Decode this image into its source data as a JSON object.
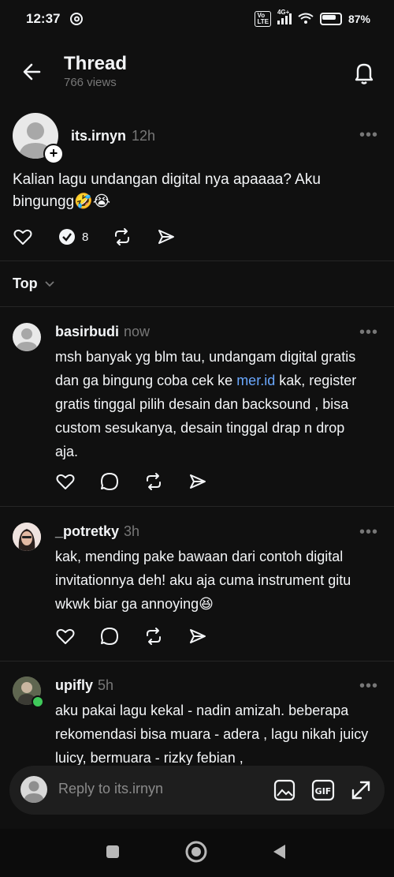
{
  "status_bar": {
    "time": "12:37",
    "network": "4G+",
    "battery": "87%"
  },
  "header": {
    "title": "Thread",
    "views": "766 views"
  },
  "post": {
    "username": "its.irnyn",
    "time": "12h",
    "text": "Kalian lagu undangan digital nya apaaaa? Aku bingungg🤣😭",
    "reply_count": "8"
  },
  "sort": {
    "label": "Top"
  },
  "replies": [
    {
      "username": "basirbudi",
      "time": "now",
      "text_before": "msh banyak yg blm tau, undangam digital gratis dan ga bingung coba cek ke ",
      "link": "mer.id",
      "text_after": " kak, register gratis tinggal pilih desain dan backsound , bisa custom sesukanya, desain tinggal drap n drop aja."
    },
    {
      "username": "_potretky",
      "time": "3h",
      "text": "kak, mending pake bawaan dari contoh digital invitationnya deh! aku aja cuma instrument gitu wkwk biar ga annoying😆"
    },
    {
      "username": "upifly",
      "time": "5h",
      "text": "aku pakai lagu kekal - nadin amizah. beberapa rekomendasi bisa muara - adera , lagu nikah juicy luicy, bermuara - rizky febian ,"
    }
  ],
  "composer": {
    "placeholder": "Reply to its.irnyn"
  },
  "colors": {
    "background": "#101010",
    "muted": "#777777",
    "link": "#6aa8ff"
  }
}
